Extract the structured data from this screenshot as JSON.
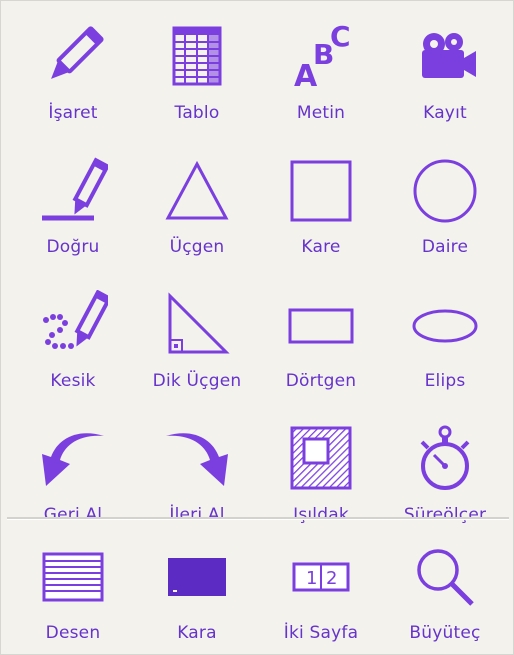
{
  "accent_color": "#7b3fe0",
  "label_color": "#6633cc",
  "tools": [
    {
      "label": "İşaret",
      "icon": "pen-icon"
    },
    {
      "label": "Tablo",
      "icon": "table-icon"
    },
    {
      "label": "Metin",
      "icon": "text-abc-icon"
    },
    {
      "label": "Kayıt",
      "icon": "video-camera-icon"
    },
    {
      "label": "Doğru",
      "icon": "line-pen-icon"
    },
    {
      "label": "Üçgen",
      "icon": "triangle-icon"
    },
    {
      "label": "Kare",
      "icon": "square-icon"
    },
    {
      "label": "Daire",
      "icon": "circle-icon"
    },
    {
      "label": "Kesik",
      "icon": "dashed-pen-icon"
    },
    {
      "label": "Dik Üçgen",
      "icon": "right-triangle-icon"
    },
    {
      "label": "Dörtgen",
      "icon": "rectangle-icon"
    },
    {
      "label": "Elips",
      "icon": "ellipse-icon"
    },
    {
      "label": "Geri Al",
      "icon": "undo-arrow-icon"
    },
    {
      "label": "İleri Al",
      "icon": "redo-arrow-icon"
    },
    {
      "label": "Işıldak",
      "icon": "spotlight-icon"
    },
    {
      "label": "Süreölçer",
      "icon": "stopwatch-icon"
    }
  ],
  "bottom_tools": [
    {
      "label": "Desen",
      "icon": "pattern-lines-icon"
    },
    {
      "label": "Kara",
      "icon": "blackboard-icon"
    },
    {
      "label": "İki Sayfa",
      "icon": "two-page-icon"
    },
    {
      "label": "Büyüteç",
      "icon": "magnifier-icon"
    }
  ],
  "two_page_numbers": [
    "1",
    "2"
  ],
  "text_icon_letters": [
    "A",
    "B",
    "C"
  ]
}
